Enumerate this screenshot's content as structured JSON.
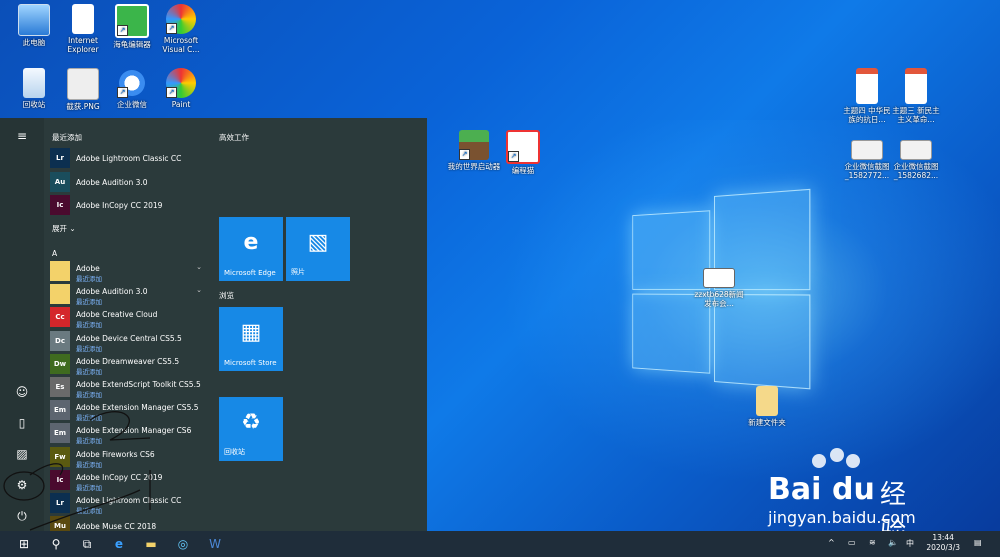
{
  "desktop": {
    "icons": [
      {
        "name": "此电脑",
        "icon": "computer-icon"
      },
      {
        "name": "Internet Explorer",
        "icon": "file-icon"
      },
      {
        "name": "海龟编辑器",
        "icon": "turtle-editor-icon"
      },
      {
        "name": "Microsoft Visual C...",
        "icon": "paint-icon"
      },
      {
        "name": "回收站",
        "icon": "recycle-bin-icon"
      },
      {
        "name": "截获.PNG",
        "icon": "image-file-icon"
      },
      {
        "name": "企业微信",
        "icon": "wecom-icon"
      },
      {
        "name": "Paint",
        "icon": "paint-icon"
      },
      {
        "name": "我的世界启动器",
        "icon": "minecraft-icon"
      },
      {
        "name": "编程猫",
        "icon": "codemao-icon"
      },
      {
        "name": "主题四 中华民族的抗日...",
        "icon": "ppt-icon"
      },
      {
        "name": "主题三 新民主主义革命...",
        "icon": "ppt-icon"
      },
      {
        "name": "企业微信截图_1582772...",
        "icon": "screenshot-icon"
      },
      {
        "name": "企业微信截图_1582682...",
        "icon": "screenshot-icon"
      },
      {
        "name": "zzxtb628新闻发布会...",
        "icon": "document-icon"
      },
      {
        "name": "新建文件夹",
        "icon": "folder-icon"
      }
    ]
  },
  "start_menu": {
    "recent_header": "最近添加",
    "expand_label": "展开",
    "letter_a": "A",
    "recent_tag": "最近添加",
    "recent_apps": [
      {
        "name": "Adobe Lightroom Classic CC",
        "badge": "Lr",
        "color": "#0c2f50"
      },
      {
        "name": "Adobe Audition 3.0",
        "badge": "Au",
        "color": "#1a4d5c"
      },
      {
        "name": "Adobe InCopy CC 2019",
        "badge": "Ic",
        "color": "#4a0a2e"
      }
    ],
    "apps": [
      {
        "name": "Adobe",
        "badge": "",
        "color": "#f3d26a",
        "tag": true,
        "chevron": true
      },
      {
        "name": "Adobe Audition 3.0",
        "badge": "",
        "color": "#f3d26a",
        "tag": true,
        "chevron": true
      },
      {
        "name": "Adobe Creative Cloud",
        "badge": "Cc",
        "color": "#d4262b",
        "tag": true
      },
      {
        "name": "Adobe Device Central CS5.5",
        "badge": "Dc",
        "color": "#6a7a80",
        "tag": true
      },
      {
        "name": "Adobe Dreamweaver CS5.5",
        "badge": "Dw",
        "color": "#3f6b1f",
        "tag": true
      },
      {
        "name": "Adobe ExtendScript Toolkit CS5.5",
        "badge": "Es",
        "color": "#6a6a6a",
        "tag": true
      },
      {
        "name": "Adobe Extension Manager CS5.5",
        "badge": "Em",
        "color": "#5d6570",
        "tag": true
      },
      {
        "name": "Adobe Extension Manager CS6",
        "badge": "Em",
        "color": "#5d6570",
        "tag": true
      },
      {
        "name": "Adobe Fireworks CS6",
        "badge": "Fw",
        "color": "#5a5a10",
        "tag": true
      },
      {
        "name": "Adobe InCopy CC 2019",
        "badge": "Ic",
        "color": "#4a0a2e",
        "tag": true
      },
      {
        "name": "Adobe Lightroom Classic CC",
        "badge": "Lr",
        "color": "#0c2f50",
        "tag": true
      },
      {
        "name": "Adobe Muse CC 2018",
        "badge": "Mu",
        "color": "#5a4a10",
        "tag": false
      }
    ],
    "tiles_groups": [
      {
        "title": "高效工作"
      },
      {
        "title": "浏览"
      }
    ],
    "tiles": [
      {
        "label": "Microsoft Edge",
        "glyph": "e",
        "icon": "edge-icon"
      },
      {
        "label": "照片",
        "glyph": "▧",
        "icon": "photos-icon"
      },
      {
        "label": "Microsoft Store",
        "glyph": "▦",
        "icon": "store-icon"
      },
      {
        "label": "回收站",
        "glyph": "♻",
        "icon": "recycle-bin-icon"
      }
    ]
  },
  "taskbar": {
    "ime": "中",
    "time": "13:44",
    "date": "2020/3/3"
  },
  "watermark": {
    "brand": "Bai",
    "brand2": "du",
    "cn": "经验",
    "url": "jingyan.baidu.com"
  }
}
